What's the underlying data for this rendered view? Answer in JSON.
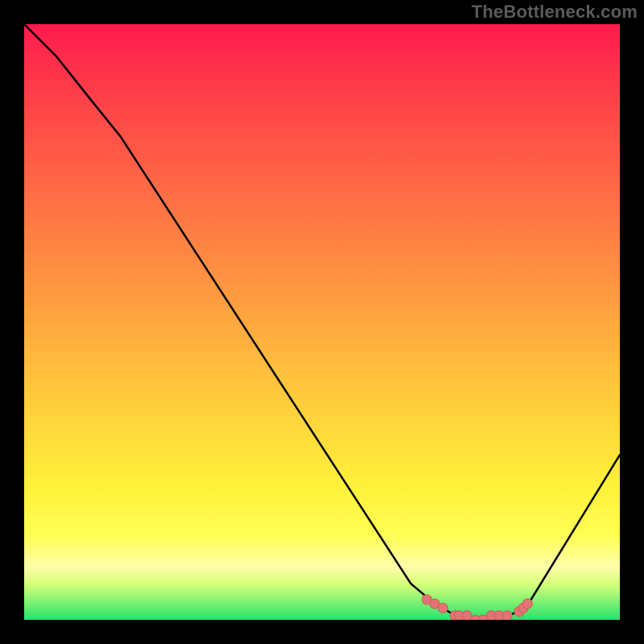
{
  "watermark": "TheBottleneck.com",
  "colors": {
    "frame_bg": "#000000",
    "gradient_top": "#ff1a4e",
    "gradient_bottom": "#26e36b",
    "curve": "#000000",
    "marker_fill": "#e57373",
    "marker_stroke": "#c75c5c"
  },
  "chart_data": {
    "type": "line",
    "title": "",
    "xlabel": "",
    "ylabel": "",
    "xlim": [
      0,
      100
    ],
    "ylim": [
      0,
      100
    ],
    "series": [
      {
        "name": "bottleneck-curve",
        "x": [
          0,
          5.4,
          10.8,
          16.2,
          64.9,
          68.9,
          70.3,
          72.3,
          73.0,
          74.3,
          75.7,
          77.0,
          78.4,
          79.7,
          81.1,
          83.1,
          83.8,
          85.1,
          100
        ],
        "y": [
          100,
          94.6,
          87.8,
          81.1,
          6.1,
          2.7,
          2.0,
          0.7,
          0.7,
          0.7,
          0.0,
          0.0,
          0.7,
          0.7,
          0.7,
          1.4,
          2.0,
          3.4,
          27.7
        ]
      }
    ],
    "markers": {
      "name": "highlight-dots",
      "x": [
        67.6,
        68.9,
        70.3,
        72.3,
        73.0,
        74.3,
        75.7,
        77.0,
        78.4,
        79.7,
        81.1,
        83.1,
        83.8,
        84.5
      ],
      "y": [
        3.4,
        2.7,
        2.0,
        0.7,
        0.7,
        0.7,
        0.0,
        0.0,
        0.7,
        0.7,
        0.7,
        1.4,
        2.0,
        2.7
      ]
    }
  }
}
